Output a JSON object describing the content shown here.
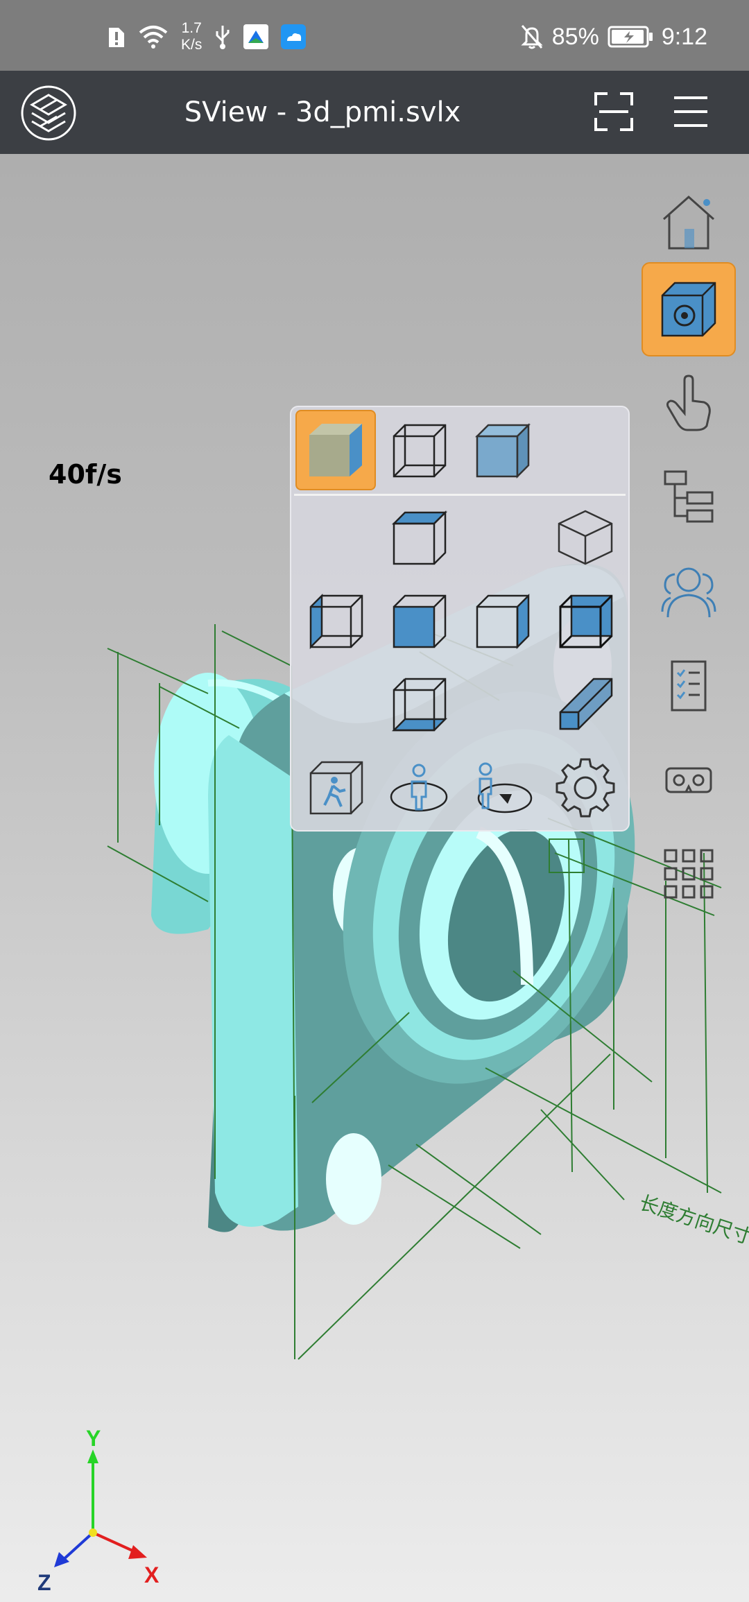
{
  "status_bar": {
    "net_speed_value": "1.7",
    "net_speed_unit": "K/s",
    "battery": "85%",
    "time": "9:12"
  },
  "app_bar": {
    "title": "SView - 3d_pmi.svlx",
    "icons": [
      "logo-icon",
      "fullscreen-icon",
      "menu-icon"
    ]
  },
  "viewport": {
    "fps": "40f/s",
    "annotation_text": "长度方向尺寸",
    "axes": {
      "x": "X",
      "y": "Y",
      "z": "Z"
    }
  },
  "view_panel": {
    "selected": "shaded-render",
    "render_modes": [
      "shaded-render-icon",
      "wireframe-render-icon",
      "transparent-render-icon"
    ],
    "view_orientations": [
      "top-view-icon",
      "isometric-view-icon",
      "left-view-icon",
      "front-view-icon",
      "right-view-icon",
      "back-view-icon",
      "bottom-view-icon",
      "section-view-icon"
    ],
    "extra_tools": [
      "walkthrough-icon",
      "orbit-person-icon",
      "orbit-person-arrow-icon",
      "settings-gear-icon"
    ]
  },
  "right_toolbar": {
    "selected": "view-settings",
    "items": [
      "home-icon",
      "view-settings-icon",
      "gesture-icon",
      "model-tree-icon",
      "users-icon",
      "checklist-icon",
      "vr-icon",
      "apps-grid-icon"
    ]
  },
  "colors": {
    "accent": "#f6a94a",
    "model": "#9ff5f1",
    "annotation": "#2e7d32",
    "app_bar": "#3c3f44"
  }
}
